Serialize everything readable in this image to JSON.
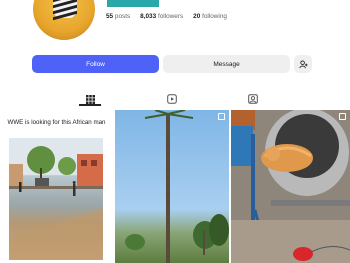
{
  "profile": {
    "stats": [
      {
        "value": "55",
        "label": "posts"
      },
      {
        "value": "8,033",
        "label": "followers"
      },
      {
        "value": "20",
        "label": "following"
      }
    ]
  },
  "actions": {
    "follow_label": "Follow",
    "message_label": "Message"
  },
  "tabs": [
    {
      "icon": "grid-icon",
      "active": true
    },
    {
      "icon": "reels-icon",
      "active": false
    },
    {
      "icon": "tagged-icon",
      "active": false
    }
  ],
  "posts": [
    {
      "caption": "WWE is looking for this African man"
    },
    {
      "caption": ""
    },
    {
      "caption": ""
    }
  ],
  "colors": {
    "accent": "#4e62f7",
    "button_bg": "#efefef"
  }
}
